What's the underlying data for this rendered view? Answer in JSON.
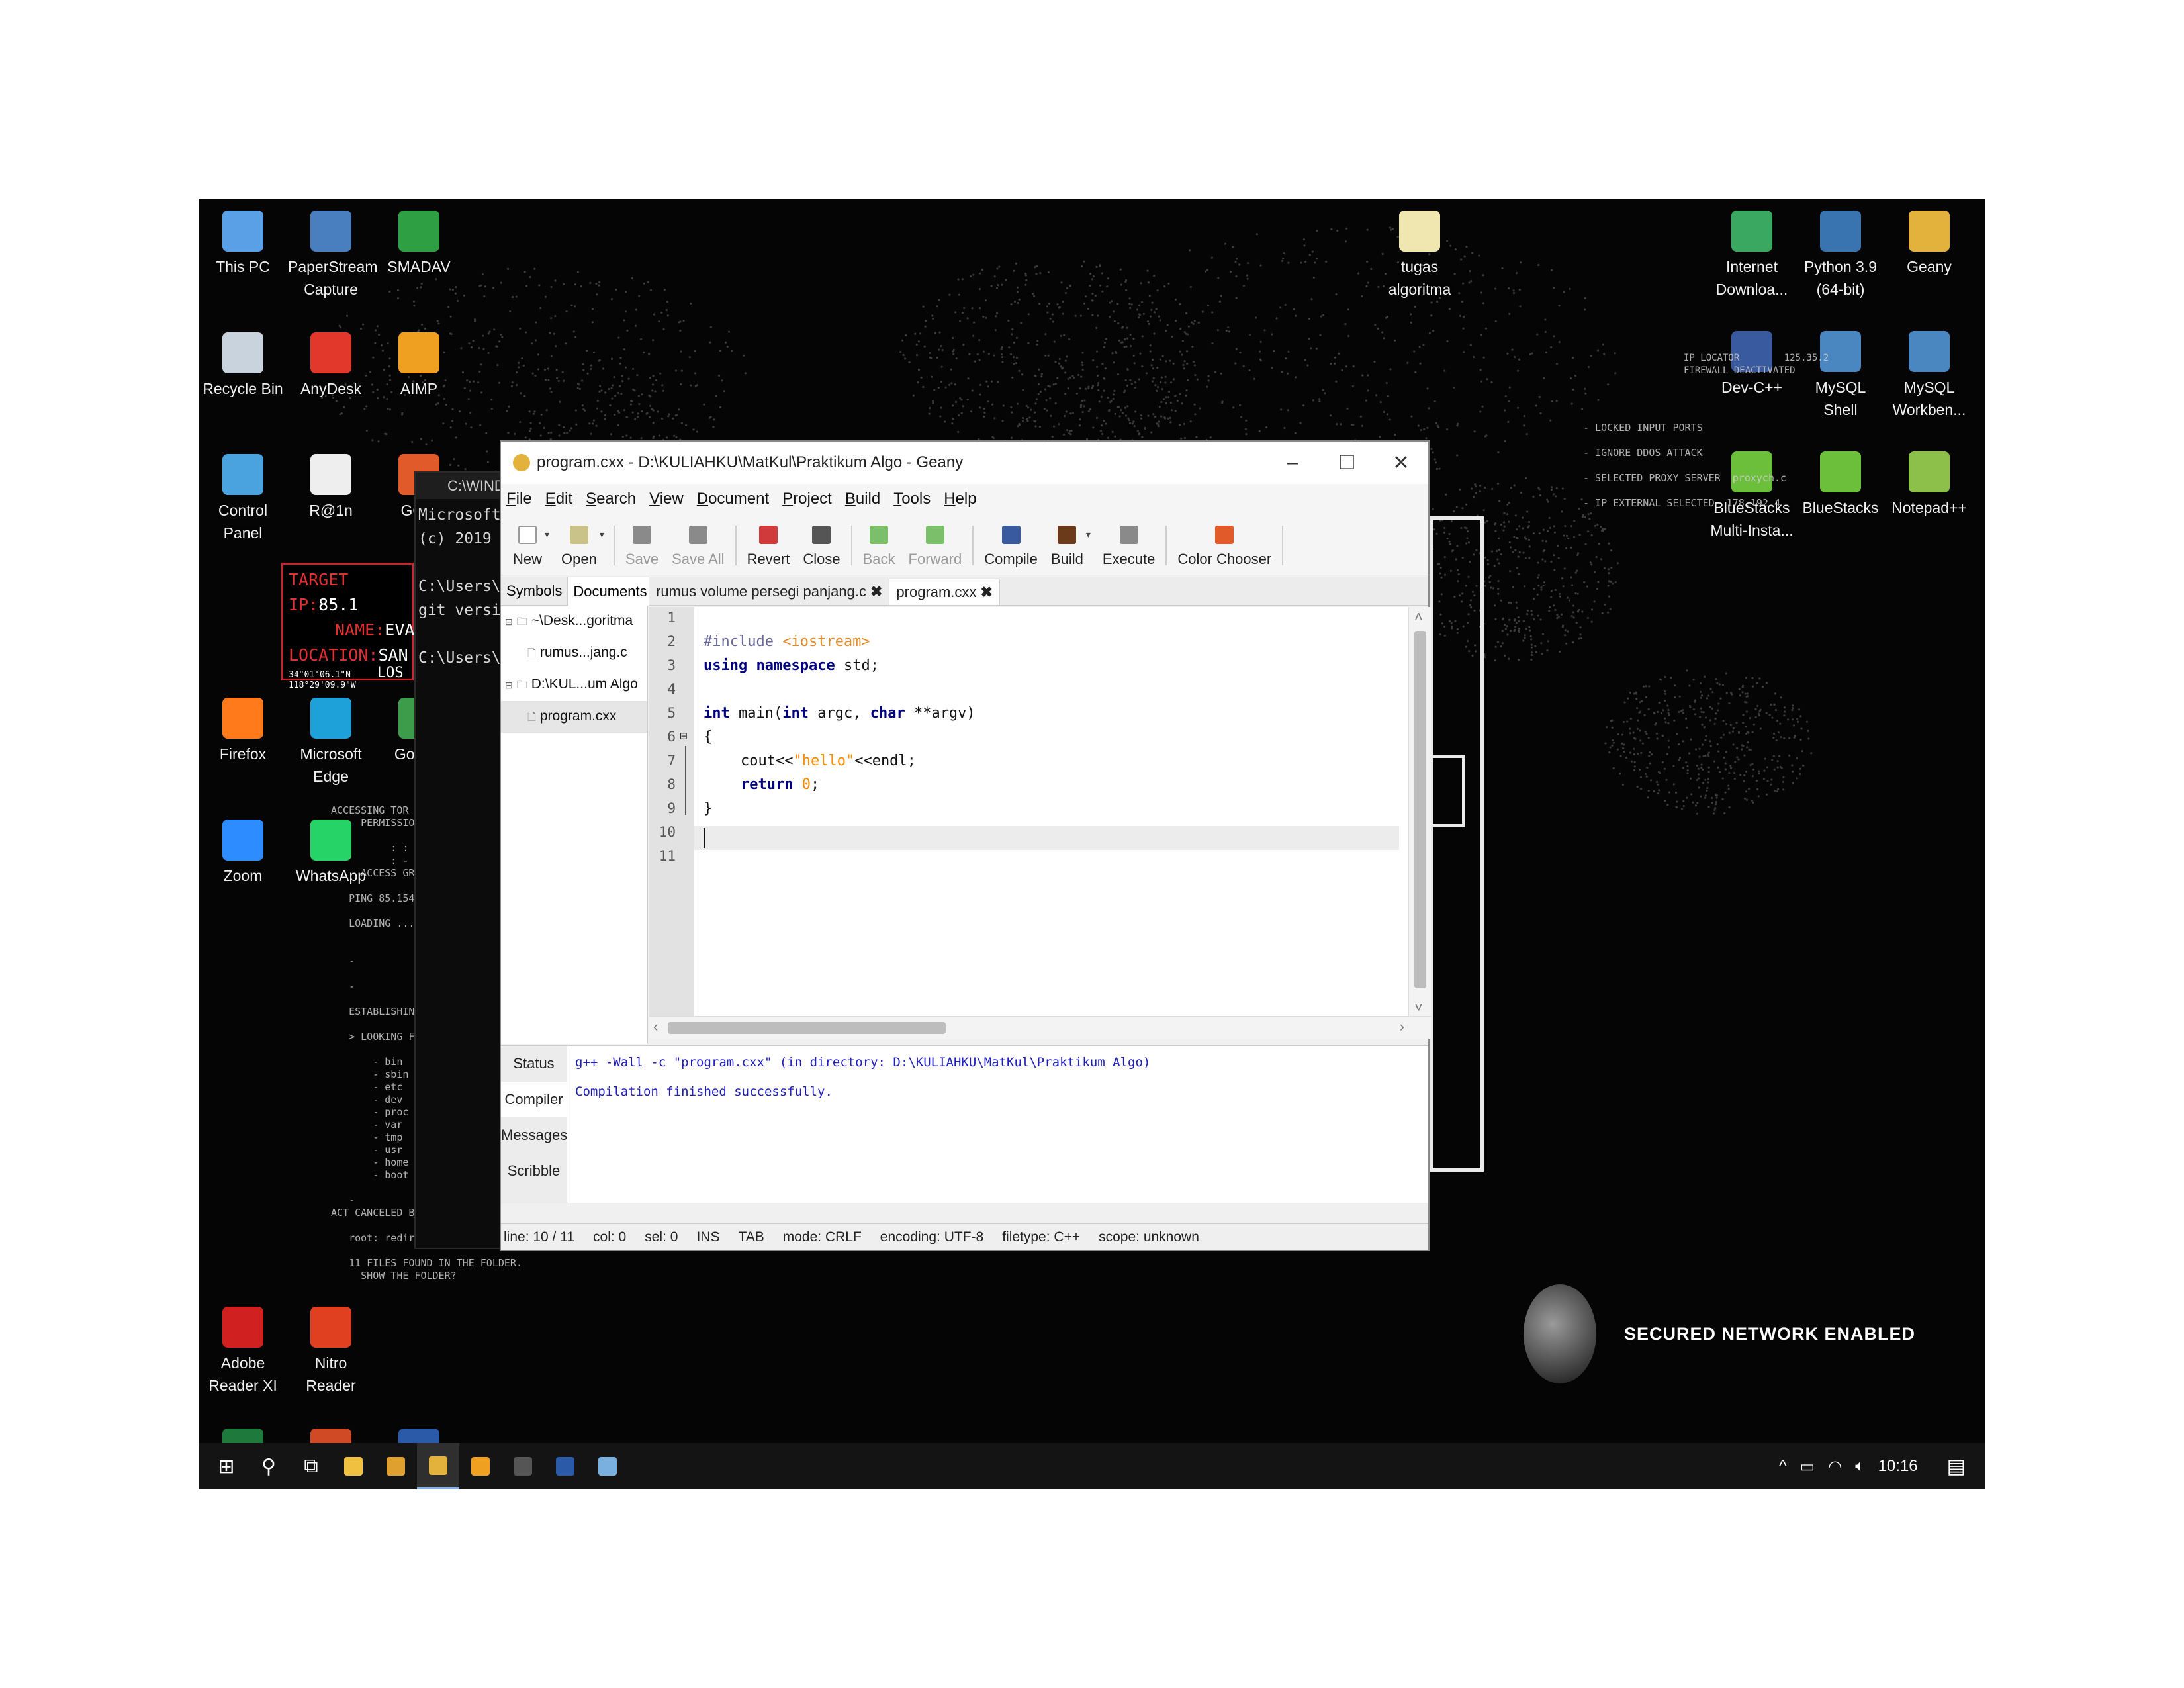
{
  "desktop": {
    "icons_left": [
      {
        "label": "This PC",
        "icon": "computer-icon",
        "color": "#5aa0e6"
      },
      {
        "label": "PaperStream Capture",
        "icon": "scanner-icon",
        "color": "#4a7fbf"
      },
      {
        "label": "SMADAV",
        "icon": "smadav-icon",
        "color": "#2ea043"
      },
      {
        "label": "Recycle Bin",
        "icon": "recycle-bin-icon",
        "color": "#c9d3dd"
      },
      {
        "label": "AnyDesk",
        "icon": "anydesk-icon",
        "color": "#e2382b"
      },
      {
        "label": "AIMP",
        "icon": "aimp-icon",
        "color": "#f0a020"
      },
      {
        "label": "Control Panel",
        "icon": "control-panel-icon",
        "color": "#4aa3df"
      },
      {
        "label": "R@1n",
        "icon": "file-icon",
        "color": "#eeeeee"
      },
      {
        "label": "GOM",
        "icon": "gom-icon",
        "color": "#e05a2a"
      },
      {
        "label": "Firefox",
        "icon": "firefox-icon",
        "color": "#ff7a1a"
      },
      {
        "label": "Microsoft Edge",
        "icon": "edge-icon",
        "color": "#1ea0d8"
      },
      {
        "label": "Go Chr",
        "icon": "chrome-icon",
        "color": "#3c9c4a"
      },
      {
        "label": "Zoom",
        "icon": "zoom-icon",
        "color": "#2d8cff"
      },
      {
        "label": "WhatsApp",
        "icon": "whatsapp-icon",
        "color": "#25d366"
      },
      {
        "label": "Adobe Reader XI",
        "icon": "adobe-reader-icon",
        "color": "#d02020"
      },
      {
        "label": "Nitro Reader",
        "icon": "nitro-icon",
        "color": "#e04020"
      },
      {
        "label": "Excel 2013",
        "icon": "excel-icon",
        "color": "#1e7a3c"
      },
      {
        "label": "PowerPoint 2013",
        "icon": "powerpoint-icon",
        "color": "#d04a26"
      },
      {
        "label": "Word 2013",
        "icon": "word-icon",
        "color": "#2a5aa8"
      }
    ],
    "icons_right": [
      {
        "label": "tugas algoritma",
        "icon": "folder-icon",
        "color": "#f0e6b0"
      },
      {
        "label": "Internet Downloa...",
        "icon": "idm-icon",
        "color": "#3aa860"
      },
      {
        "label": "Python 3.9 (64-bit)",
        "icon": "python-icon",
        "color": "#3a74b0"
      },
      {
        "label": "Geany",
        "icon": "geany-icon",
        "color": "#e3b23c"
      },
      {
        "label": "Dev-C++",
        "icon": "devcpp-icon",
        "color": "#3a5aa0"
      },
      {
        "label": "MySQL Shell",
        "icon": "mysql-shell-icon",
        "color": "#4a86c0"
      },
      {
        "label": "MySQL Workben...",
        "icon": "mysql-workbench-icon",
        "color": "#4a86c0"
      },
      {
        "label": "BlueStacks Multi-Insta...",
        "icon": "bluestacks-multi-icon",
        "color": "#6cbf3a"
      },
      {
        "label": "BlueStacks",
        "icon": "bluestacks-icon",
        "color": "#6cbf3a"
      },
      {
        "label": "Notepad++",
        "icon": "notepadpp-icon",
        "color": "#8cc04a"
      }
    ],
    "target": {
      "ip_label": "TARGET IP:",
      "ip_value": "85.1",
      "name_label": "NAME:",
      "name_value": "EVA",
      "location_label": "LOCATION:",
      "location_value": "SAN",
      "coords_1": "34°01'06.1\"N",
      "coords_2": "118°29'09.9\"W",
      "coords_extra": "LOS"
    },
    "hack_text_left": "ACCESSING TOR\n     PERMISSIO\n\n          : :\n          : -\n     ACCESS GR\n\n   PING 85.154.2\n\n   LOADING ... C\n\n\n   -\n\n   -\n\n   ESTABLISHING\n\n   > LOOKING FOR\n\n       - bin\n       - sbin\n       - etc\n       - dev\n       - proc\n       - var\n       - tmp\n       - usr\n       - home\n       - boot\n\n   -\nACT CANCELED BY THE USE\n\n   root: redir /sbin\n\n   11 FILES FOUND IN THE FOLDER.\n     SHOW THE FOLDER?",
    "hack_text_right": "- LOCKED INPUT PORTS\n\n- IGNORE DDOS ATTACK\n\n- SELECTED PROXY SERVER  proxych.c\n\n- IP EXTERNAL SELECTED  178.192.4",
    "hack_text_ip_locator": "IP LOCATOR        125.35.2\nFIREWALL DEACTIVATED",
    "secured_text": "SECURED NETWORK ENABLED"
  },
  "cmd": {
    "title": "C:\\WIND",
    "lines": [
      "Microsoft",
      "(c) 2019 M",
      "",
      "C:\\Users\\V",
      "git versio",
      "",
      "C:\\Users\\V"
    ]
  },
  "geany": {
    "title": "program.cxx - D:\\KULIAHKU\\MatKul\\Praktikum Algo - Geany",
    "window_controls": {
      "minimize": "–",
      "maximize": "☐",
      "close": "✕"
    },
    "menu": [
      "File",
      "Edit",
      "Search",
      "View",
      "Document",
      "Project",
      "Build",
      "Tools",
      "Help"
    ],
    "toolbar": [
      {
        "label": "New",
        "icon": "new-file-icon",
        "enabled": true,
        "color": "#ffffff"
      },
      {
        "label": "Open",
        "icon": "open-folder-icon",
        "enabled": true,
        "color": "#c9c38a"
      },
      {
        "label": "Save",
        "icon": "save-icon",
        "enabled": false,
        "color": "#8a8a8a"
      },
      {
        "label": "Save All",
        "icon": "save-all-icon",
        "enabled": false,
        "color": "#8a8a8a"
      },
      {
        "label": "Revert",
        "icon": "revert-icon",
        "enabled": true,
        "color": "#d03a3a"
      },
      {
        "label": "Close",
        "icon": "close-doc-icon",
        "enabled": true,
        "color": "#555555"
      },
      {
        "label": "Back",
        "icon": "back-arrow-icon",
        "enabled": false,
        "color": "#7cbf6a"
      },
      {
        "label": "Forward",
        "icon": "forward-arrow-icon",
        "enabled": false,
        "color": "#7cbf6a"
      },
      {
        "label": "Compile",
        "icon": "compile-icon",
        "enabled": true,
        "color": "#3a5aa0"
      },
      {
        "label": "Build",
        "icon": "build-icon",
        "enabled": true,
        "color": "#6a3a1a"
      },
      {
        "label": "Execute",
        "icon": "execute-gears-icon",
        "enabled": true,
        "color": "#8a8a8a"
      },
      {
        "label": "Color Chooser",
        "icon": "color-chooser-icon",
        "enabled": true,
        "color": "#e05a2a"
      }
    ],
    "side_tabs": [
      "Symbols",
      "Documents"
    ],
    "side_tree": [
      {
        "label": "~\\Desk...goritma",
        "type": "folder"
      },
      {
        "label": "rumus...jang.c",
        "type": "file"
      },
      {
        "label": "D:\\KUL...um Algo",
        "type": "folder"
      },
      {
        "label": "program.cxx",
        "type": "file",
        "selected": true
      }
    ],
    "doc_tabs": [
      {
        "label": "rumus volume persegi panjang.c",
        "active": false
      },
      {
        "label": "program.cxx",
        "active": true
      }
    ],
    "line_numbers": [
      "1",
      "2",
      "3",
      "4",
      "5",
      "6",
      "7",
      "8",
      "9",
      "10",
      "11"
    ],
    "code": {
      "l2_pp": "#include",
      "l2_inc": "<iostream>",
      "l3_kw1": "using",
      "l3_kw2": "namespace",
      "l3_rest": "std;",
      "l5_kw1": "int",
      "l5_mid": "main(",
      "l5_kw2": "int",
      "l5_mid2": "argc,",
      "l5_kw3": "char",
      "l5_rest": "**argv)",
      "l6": "{",
      "l7_pre": "cout<<",
      "l7_str": "\"hello\"",
      "l7_post": "<<endl;",
      "l8_kw": "return",
      "l8_num": "0",
      "l8_post": ";",
      "l9": "}"
    },
    "msg_tabs": [
      "Status",
      "Compiler",
      "Messages",
      "Scribble"
    ],
    "compiler_output": [
      "g++ -Wall -c \"program.cxx\" (in directory: D:\\KULIAHKU\\MatKul\\Praktikum Algo)",
      "Compilation finished successfully."
    ],
    "status": {
      "line": "line: 10 / 11",
      "col": "col: 0",
      "sel": "sel: 0",
      "ins": "INS",
      "tab": "TAB",
      "mode": "mode: CRLF",
      "encoding": "encoding: UTF-8",
      "filetype": "filetype: C++",
      "scope": "scope: unknown"
    }
  },
  "taskbar": {
    "items": [
      {
        "name": "start-button",
        "icon": "windows-icon",
        "glyph": "⊞"
      },
      {
        "name": "search-button",
        "icon": "search-icon",
        "glyph": "⚲"
      },
      {
        "name": "task-view-button",
        "icon": "task-view-icon",
        "glyph": "⧉"
      },
      {
        "name": "file-explorer-button",
        "icon": "file-explorer-icon",
        "color": "#f0c040"
      },
      {
        "name": "chrome-button",
        "icon": "chrome-icon",
        "color": "#e0a030"
      },
      {
        "name": "geany-button",
        "icon": "geany-icon",
        "color": "#e3b23c",
        "active": true
      },
      {
        "name": "git-button",
        "icon": "git-icon",
        "color": "#f0a020"
      },
      {
        "name": "terminal-button",
        "icon": "terminal-icon",
        "color": "#555555"
      },
      {
        "name": "word-button",
        "icon": "word-icon",
        "color": "#2a5aa8"
      },
      {
        "name": "app-button",
        "icon": "app-icon",
        "color": "#7ab0e0"
      }
    ],
    "tray": {
      "chevron": "^",
      "clock": "10:16",
      "notifications_glyph": "▤"
    }
  }
}
